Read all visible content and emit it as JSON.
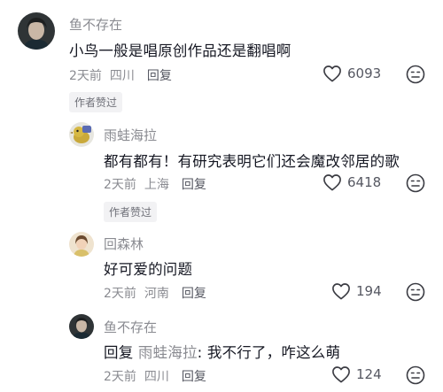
{
  "comments": [
    {
      "username": "鱼不存在",
      "text": "小鸟一般是唱原创作品还是翻唱啊",
      "time": "2天前",
      "location": "四川",
      "reply_label": "回复",
      "likes": "6093",
      "badge": "作者赞过",
      "avatar": "portrait-avatar-dark"
    },
    {
      "username": "雨蛙海拉",
      "text": "都有都有！有研究表明它们还会魔改邻居的歌",
      "time": "2天前",
      "location": "上海",
      "reply_label": "回复",
      "likes": "6418",
      "badge": "作者赞过",
      "avatar": "bird-avatar"
    },
    {
      "username": "回森林",
      "text": "好可爱的问题",
      "time": "2天前",
      "location": "河南",
      "reply_label": "回复",
      "likes": "194",
      "avatar": "girl-avatar"
    },
    {
      "username": "鱼不存在",
      "reply_prefix": "回复",
      "reply_to": "雨蛙海拉",
      "text": ": 我不行了，咋这么萌",
      "time": "2天前",
      "location": "四川",
      "reply_label": "回复",
      "likes": "124",
      "avatar": "portrait-avatar-dark"
    }
  ],
  "icons": {
    "like": "heart-outline-icon",
    "dislike": "unhappy-face-icon"
  },
  "colors": {
    "primary_text": "#161823",
    "secondary_text": "#8a8b91",
    "badge_bg": "#f2f2f4"
  }
}
